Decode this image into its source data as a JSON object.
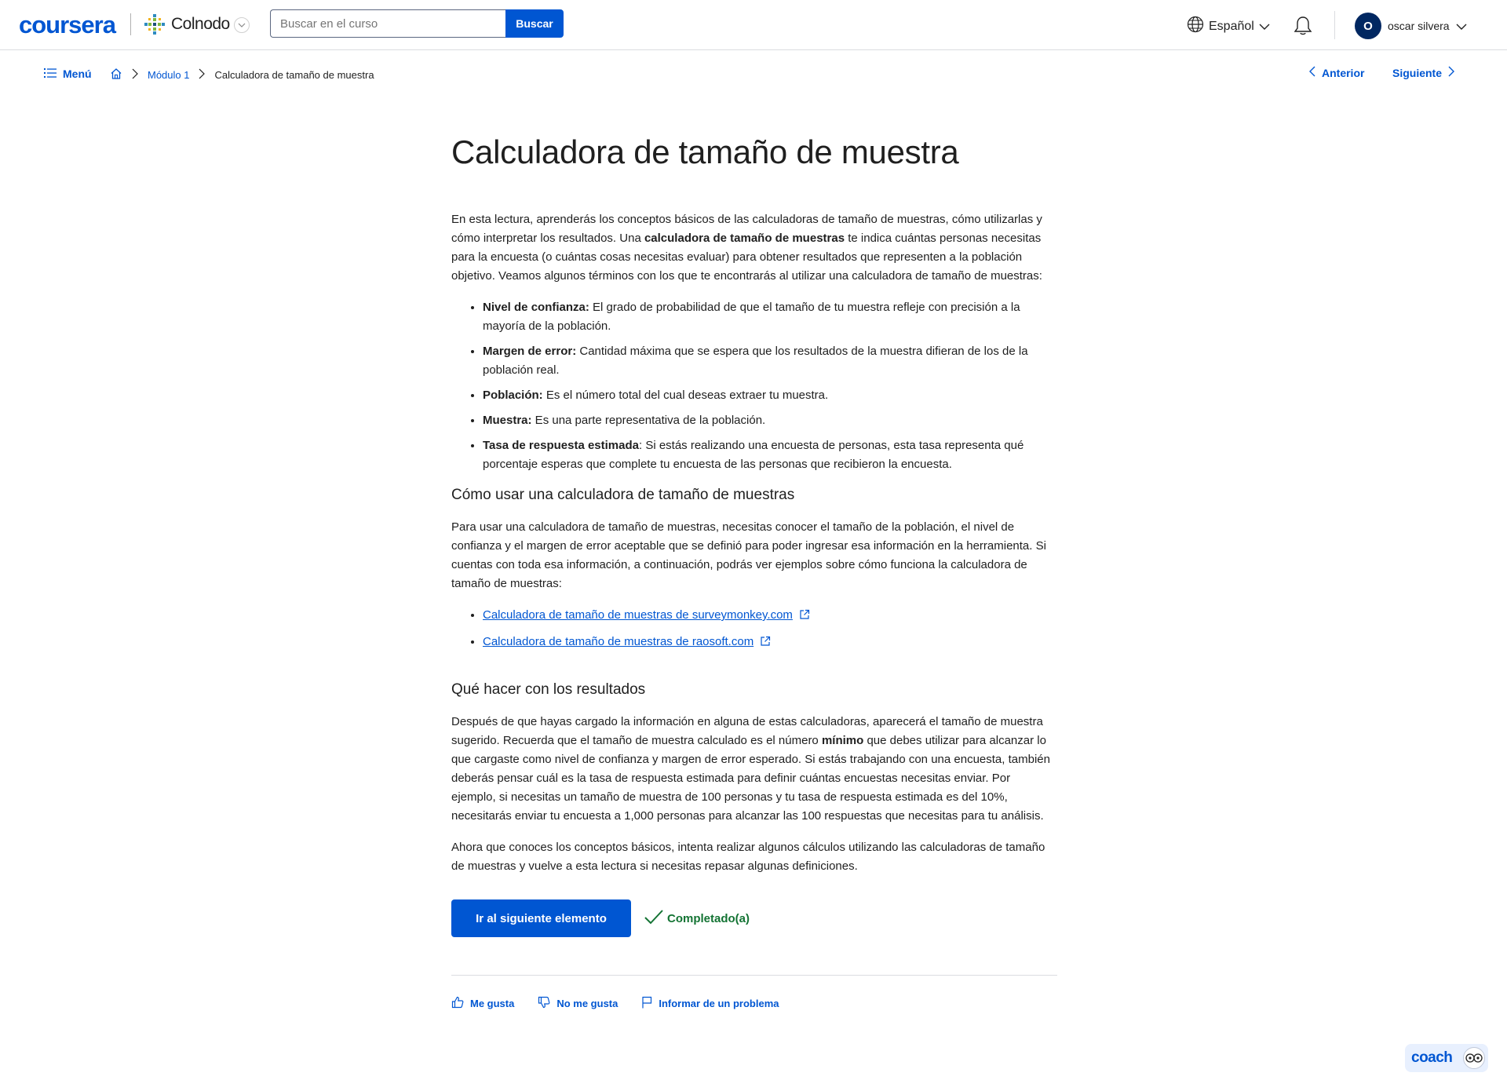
{
  "header": {
    "logo_text": "coursera",
    "partner_name": "Colnodo",
    "search_placeholder": "Buscar en el curso",
    "search_button": "Buscar",
    "language": "Español",
    "user_initial": "O",
    "user_name": "oscar silvera"
  },
  "breadcrumb": {
    "menu_label": "Menú",
    "module": "Módulo 1",
    "current": "Calculadora de tamaño de muestra",
    "prev_label": "Anterior",
    "next_label": "Siguiente"
  },
  "article": {
    "title": "Calculadora de tamaño de muestra",
    "intro_a": "En esta lectura, aprenderás los conceptos básicos de las calculadoras de tamaño de muestras, cómo utilizarlas y cómo interpretar los resultados. Una ",
    "intro_bold": "calculadora de tamaño de muestras",
    "intro_b": " te indica cuántas personas necesitas para la encuesta (o cuántas cosas necesitas evaluar) para obtener resultados que representen a la población objetivo. Veamos algunos términos con los que te encontrarás al utilizar una calculadora de tamaño de muestras:",
    "terms": [
      {
        "term": "Nivel de confianza:",
        "text": " El grado de probabilidad de que el tamaño de tu muestra refleje con precisión a la mayoría de la población."
      },
      {
        "term": "Margen de error:",
        "text": " Cantidad máxima que se espera que los resultados de la muestra difieran de los de la población real."
      },
      {
        "term": "Población:",
        "text": " Es el número total del cual deseas extraer tu muestra."
      },
      {
        "term": "Muestra:",
        "text": " Es una parte representativa de la población."
      },
      {
        "term": "Tasa de respuesta estimada",
        "text": ": Si estás realizando una encuesta de personas, esta tasa representa qué porcentaje esperas que complete tu encuesta de las personas que recibieron la encuesta."
      }
    ],
    "h2_use": "Cómo usar una calculadora de tamaño de muestras",
    "use_p": "Para usar una calculadora de tamaño de muestras, necesitas conocer el tamaño de la población, el nivel de confianza y el margen de error aceptable que se definió para poder ingresar esa información en la herramienta. Si cuentas con toda esa información, a continuación, podrás ver ejemplos sobre cómo funciona la calculadora de tamaño de muestras:",
    "links": [
      "Calculadora de tamaño de muestras de surveymonkey.com",
      "Calculadora de tamaño de muestras de raosoft.com"
    ],
    "h2_results": "Qué hacer con los resultados",
    "results_a": "Después de que hayas cargado la información en alguna de estas calculadoras, aparecerá el tamaño de muestra sugerido. Recuerda que el tamaño de muestra calculado es el número ",
    "results_bold": "mínimo",
    "results_b": " que debes utilizar para alcanzar lo que cargaste como nivel de confianza y margen de error esperado. Si estás trabajando con una encuesta, también deberás pensar cuál es la tasa de respuesta estimada para definir cuántas encuestas necesitas enviar. Por ejemplo, si necesitas un tamaño de muestra de 100 personas y tu tasa de respuesta estimada es del 10%, necesitarás enviar tu encuesta a 1,000 personas para alcanzar las 100 respuestas que necesitas para tu análisis.",
    "closing": "Ahora que conoces los conceptos básicos, intenta realizar algunos cálculos utilizando las calculadoras de tamaño de muestras y vuelve a esta lectura si necesitas repasar algunas definiciones."
  },
  "actions": {
    "next_item": "Ir al siguiente elemento",
    "completed": "Completado(a)"
  },
  "feedback": {
    "like": "Me gusta",
    "dislike": "No me gusta",
    "report": "Informar de un problema"
  },
  "coach": {
    "label": "coach"
  },
  "colors": {
    "brand": "#0056d2",
    "success": "#137333",
    "avatar": "#002761"
  }
}
